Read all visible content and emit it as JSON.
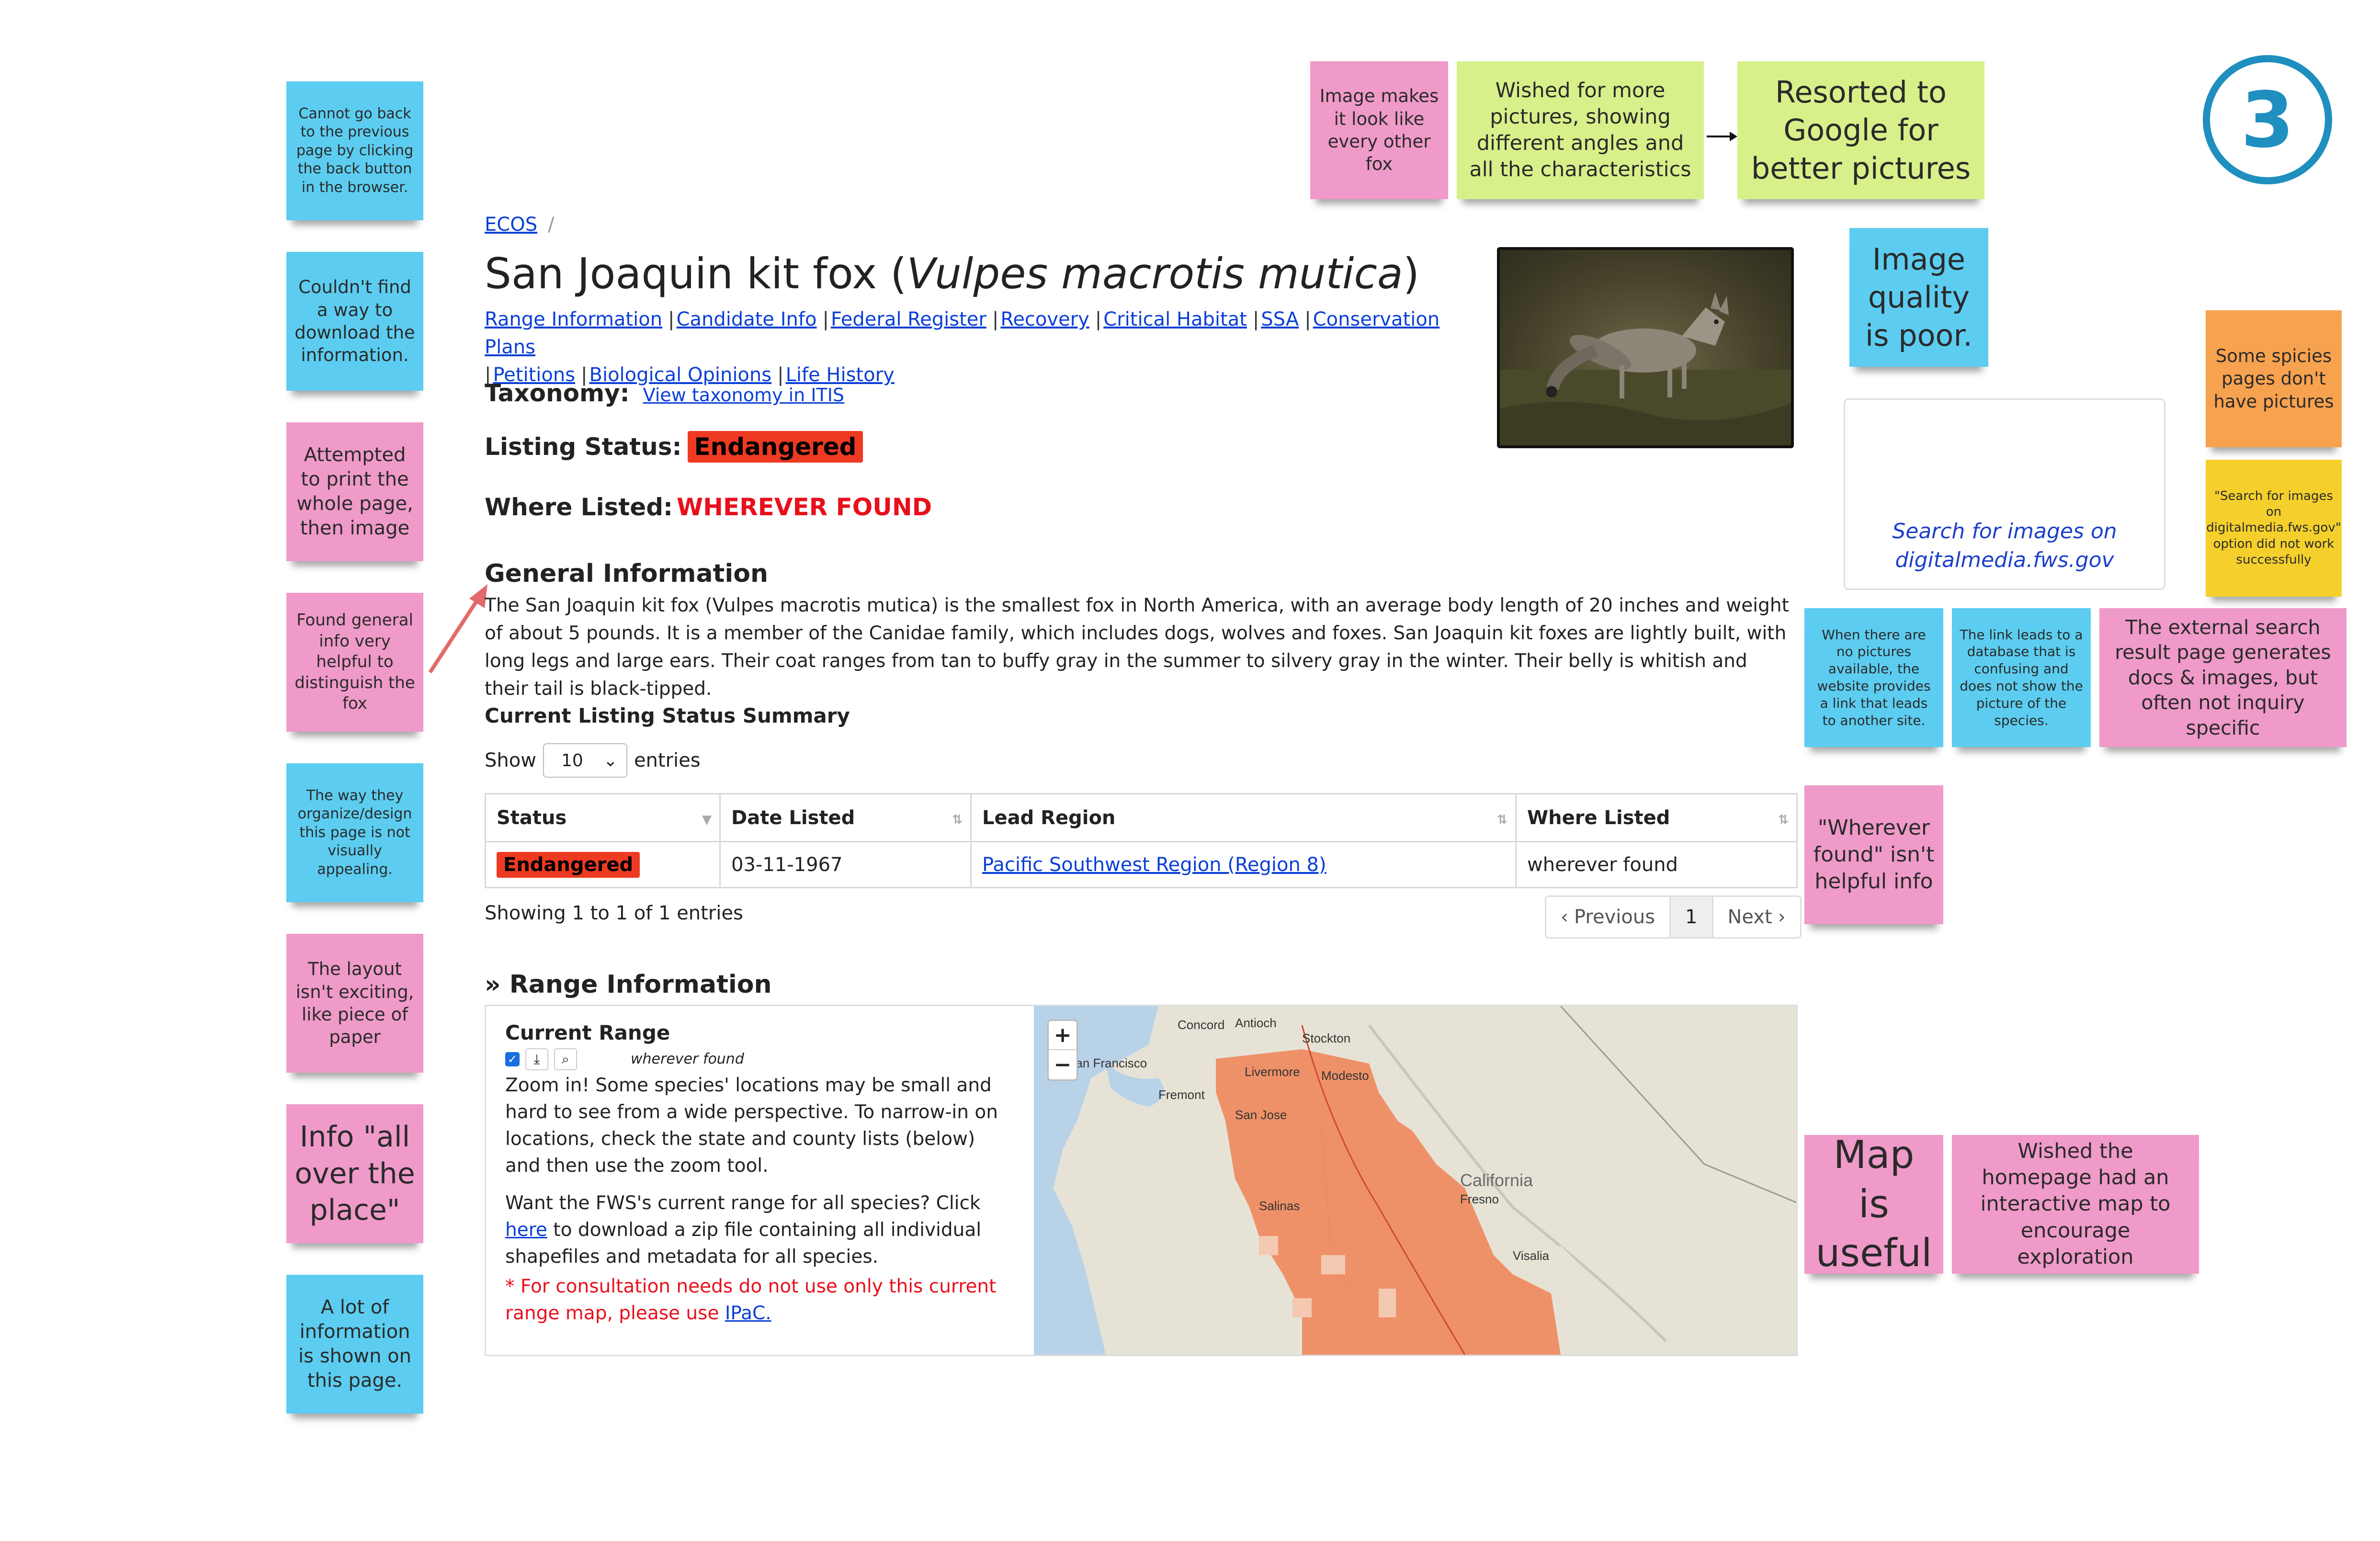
{
  "badge": "3",
  "notes": {
    "left_col": [
      "Cannot go back to the previous page by clicking the back button in the browser.",
      "Couldn't find a way to download the information.",
      "Attempted to print the whole page, then image",
      "Found general info very helpful to distinguish the fox",
      "The way they organize/design this page is not visually appealing.",
      "The layout isn't exciting, like piece of paper",
      "Info \"all over the place\"",
      "A lot of information is shown on this page."
    ],
    "top": [
      "Image makes it look like every other fox",
      "Wished for more pictures, showing different angles and all the characteristics",
      "Resorted to Google for better pictures"
    ],
    "image_quality": "Image quality is poor.",
    "no_pictures": "Some spicies pages don't have pictures",
    "search_failed": "\"Search for images on digitalmedia.fws.gov\" option did not work successfully",
    "no_pictures_link": "When there are no pictures available, the website provides a link that leads to another site.",
    "database_link": "The link leads to a database that is confusing and does not show the picture of the species.",
    "external_search": "The external search result page generates docs & images, but often not inquiry specific",
    "wherever_found": "\"Wherever found\" isn't helpful info",
    "map_useful": "Map is useful",
    "interactive_map": "Wished the homepage had an interactive map to encourage exploration"
  },
  "page": {
    "breadcrumb": "ECOS",
    "breadcrumb_sep": "/",
    "title_common": "San Joaquin kit fox (",
    "title_scientific": "Vulpes macrotis mutica",
    "title_close": ")",
    "nav_links": [
      "Range Information",
      "Candidate Info",
      "Federal Register",
      "Recovery",
      "Critical Habitat",
      "SSA",
      "Conservation Plans",
      "Petitions",
      "Biological Opinions",
      "Life History"
    ],
    "taxonomy_label": "Taxonomy:",
    "taxonomy_link": "View taxonomy in ITIS",
    "listing_status_label": "Listing Status:",
    "listing_status_value": "Endangered",
    "where_listed_label": "Where Listed:",
    "where_listed_value": "WHEREVER FOUND",
    "image_search_text": "Search for images on digitalmedia.fws.gov",
    "general_info_heading": "General Information",
    "general_info_text": "The San Joaquin kit fox (Vulpes macrotis mutica) is the smallest fox in North America, with an average body length of 20 inches and weight of about 5 pounds. It is a member of the Canidae family, which includes dogs, wolves and foxes. San Joaquin kit foxes are lightly built, with long legs and large ears. Their coat ranges from tan to buffy gray in the summer to silvery gray in the winter. Their belly is whitish and their tail is black-tipped.",
    "summary_heading": "Current Listing Status Summary",
    "show_label": "Show",
    "entries_label": "entries",
    "entries_value": "10",
    "table": {
      "headers": [
        "Status",
        "Date Listed",
        "Lead Region",
        "Where Listed"
      ],
      "row": {
        "status": "Endangered",
        "date": "03-11-1967",
        "region": "Pacific Southwest Region (Region 8)",
        "where": "wherever found"
      }
    },
    "showing_text": "Showing 1 to 1 of 1 entries",
    "pager": {
      "prev": "Previous",
      "current": "1",
      "next": "Next"
    },
    "range_heading": "» Range Information",
    "current_range_label": "Current Range",
    "current_range_layer": "wherever found",
    "zoom_text": "Zoom in! Some species' locations may be small and hard to see from a wide perspective. To narrow-in on locations, check the state and county lists (below) and then use the zoom tool.",
    "fws_text_before": "Want the FWS's current range for all species? Click ",
    "fws_link": "here",
    "fws_text_after": " to download a zip file containing all individual shapefiles and metadata for all species.",
    "consultation_text": "* For consultation needs do not use only this current range map, please use ",
    "ipac_link": "IPaC.",
    "map_labels": [
      "Concord",
      "Antioch",
      "Stockton",
      "San Francisco",
      "Livermore",
      "Modesto",
      "Fremont",
      "San Jose",
      "California",
      "Fresno",
      "Salinas",
      "Visalia"
    ],
    "zoom_in": "+",
    "zoom_out": "−"
  },
  "colors": {
    "note_blue": "#5ccdf0",
    "note_pink": "#ef9ac8",
    "note_lime": "#d7f08a",
    "note_orange": "#f7a24f",
    "note_yellow": "#f5d02c",
    "endangered_red": "#ee3a22",
    "link_blue": "#0a3fd6",
    "range_orange": "#ef8a5e"
  }
}
